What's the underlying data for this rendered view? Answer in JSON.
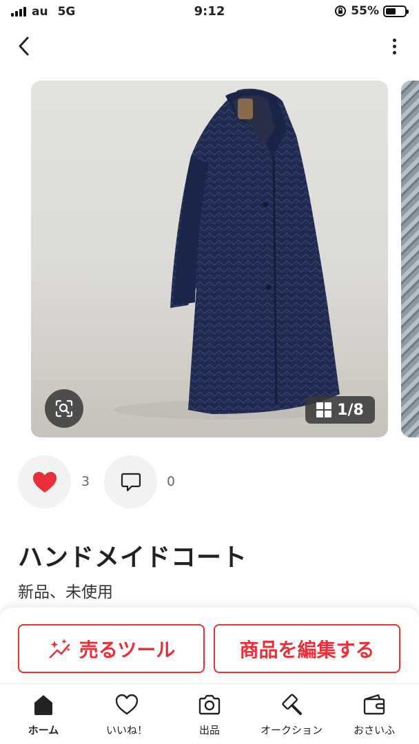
{
  "status_bar": {
    "carrier": "au",
    "network": "5G",
    "time": "9:12",
    "battery_percent": "55%",
    "battery_level": 0.55
  },
  "nav": {
    "back_icon": "chevron-left-icon",
    "more_icon": "more-vertical-icon"
  },
  "gallery": {
    "counter": "1/8",
    "current": 1,
    "total": 8,
    "zoom_icon": "zoom-scan-icon",
    "grid_icon": "grid-icon"
  },
  "social": {
    "likes": "3",
    "comments": "0",
    "like_color": "#e8303a"
  },
  "item": {
    "title": "ハンドメイドコート",
    "condition": "新品、未使用"
  },
  "actions": {
    "sell_tool": "売るツール",
    "edit_item": "商品を編集する",
    "accent_color": "#e8303a"
  },
  "tabs": [
    {
      "label": "ホーム",
      "icon": "home-icon",
      "active": true
    },
    {
      "label": "いいね！",
      "icon": "heart-icon",
      "active": false
    },
    {
      "label": "出品",
      "icon": "camera-icon",
      "active": false
    },
    {
      "label": "オークション",
      "icon": "gavel-icon",
      "active": false
    },
    {
      "label": "おさいふ",
      "icon": "wallet-icon",
      "active": false
    }
  ]
}
